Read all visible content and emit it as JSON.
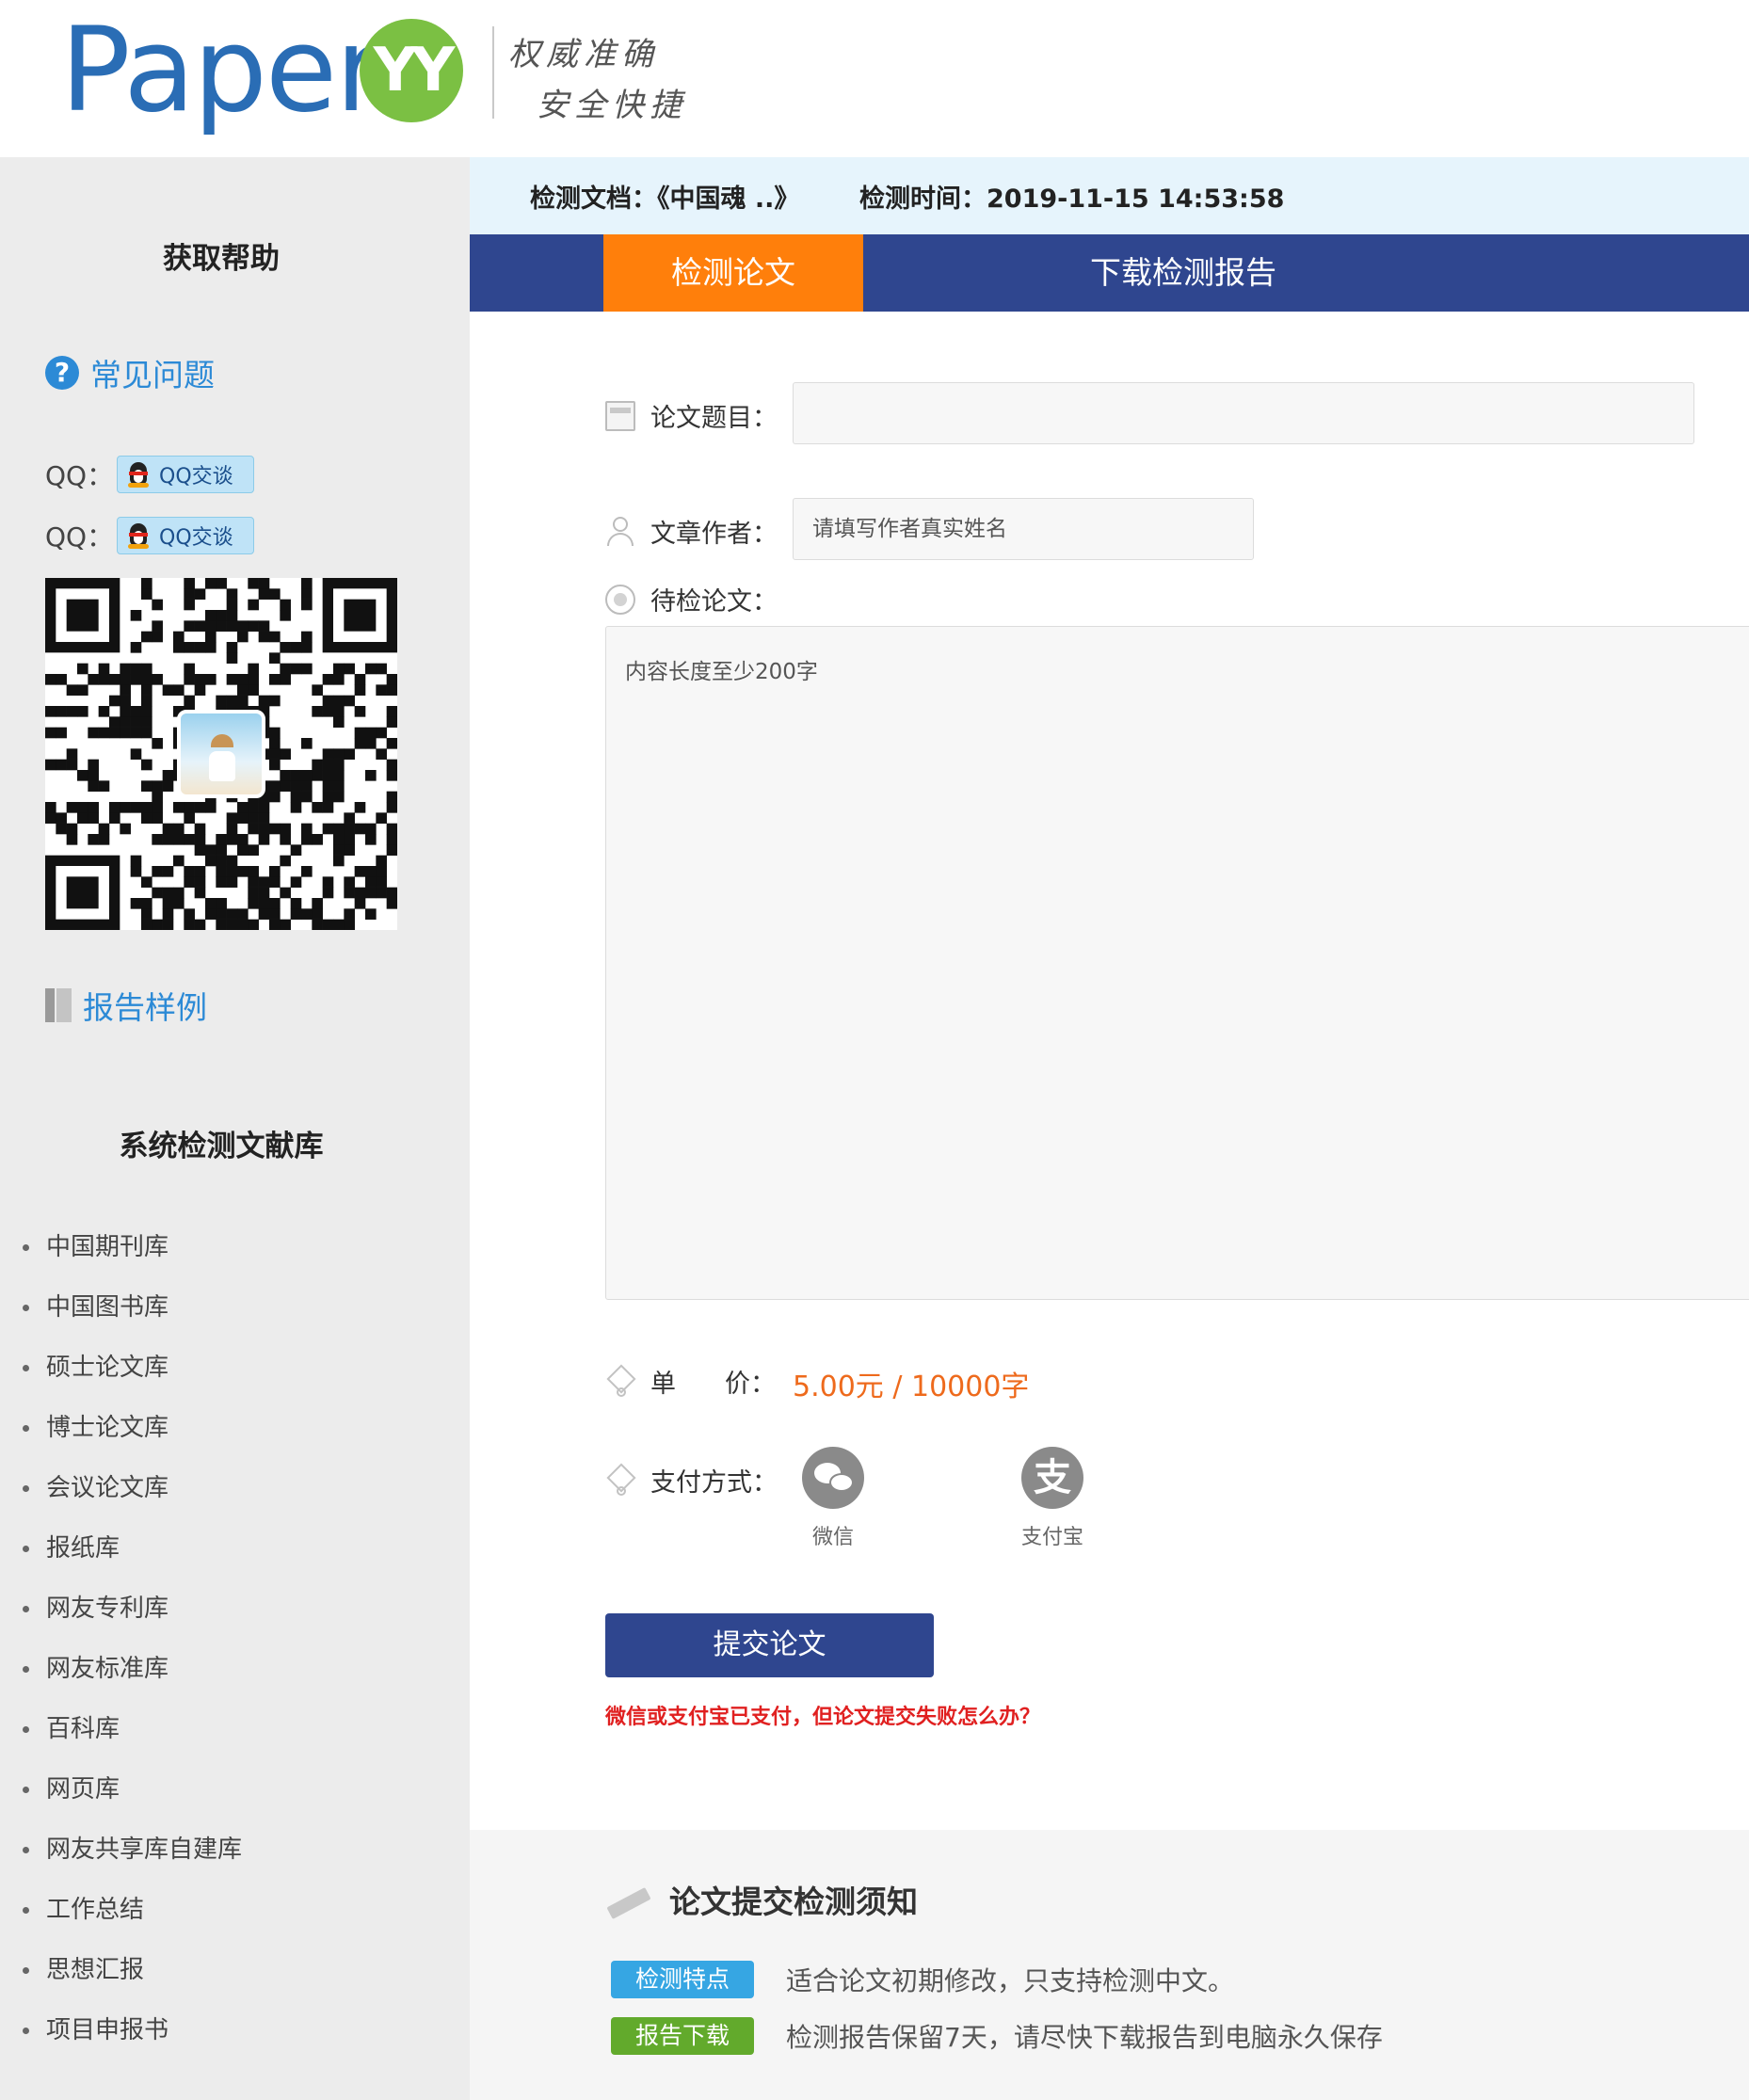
{
  "header": {
    "logo_text": "Paper",
    "logo_badge": "YY",
    "slogan_line1": "权威准确",
    "slogan_line2": "安全快捷"
  },
  "sidebar": {
    "help_title": "获取帮助",
    "faq_icon": "?",
    "faq_label": "常见问题",
    "qq_rows": [
      {
        "label": "QQ：",
        "button": "QQ交谈"
      },
      {
        "label": "QQ：",
        "button": "QQ交谈"
      }
    ],
    "report_sample_label": "报告样例",
    "library_title": "系统检测文献库",
    "libraries": [
      "中国期刊库",
      "中国图书库",
      "硕士论文库",
      "博士论文库",
      "会议论文库",
      "报纸库",
      "网友专利库",
      "网友标准库",
      "百科库",
      "网页库",
      "网友共享库自建库",
      "工作总结",
      "思想汇报",
      "项目申报书"
    ]
  },
  "infobar": {
    "doc": "检测文档：《中国魂 ..》",
    "time": "检测时间：2019-11-15 14:53:58"
  },
  "tabs": {
    "active": "检测论文",
    "download": "下载检测报告"
  },
  "form": {
    "title_label": "论文题目：",
    "title_value": "",
    "author_label": "文章作者：",
    "author_placeholder": "请填写作者真实姓名",
    "paper_label": "待检论文：",
    "paper_placeholder": "内容长度至少200字",
    "price_label_1": "单",
    "price_label_2": "价：",
    "price_value": "5.00元 / 10000字",
    "pay_label": "支付方式：",
    "pay_options": [
      {
        "name": "微信",
        "icon": "wechat-icon"
      },
      {
        "name": "支付宝",
        "icon": "alipay-icon",
        "glyph": "支"
      }
    ],
    "submit_label": "提交论文",
    "fail_link": "微信或支付宝已支付，但论文提交失败怎么办？"
  },
  "notice": {
    "title": "论文提交检测须知",
    "items": [
      {
        "badge": "检测特点",
        "badge_color": "#36a6e3",
        "text": "适合论文初期修改，只支持检测中文。"
      },
      {
        "badge": "报告下载",
        "badge_color": "#62aa2c",
        "text": "检测报告保留7天，请尽快下载报告到电脑永久保存"
      }
    ]
  },
  "colors": {
    "brand_blue": "#2a6db5",
    "nav_blue": "#2f468f",
    "active_tab": "#ff7f0b",
    "price": "#ee6a1c",
    "link_blue": "#2c8ad6",
    "warning_red": "#e02020"
  }
}
